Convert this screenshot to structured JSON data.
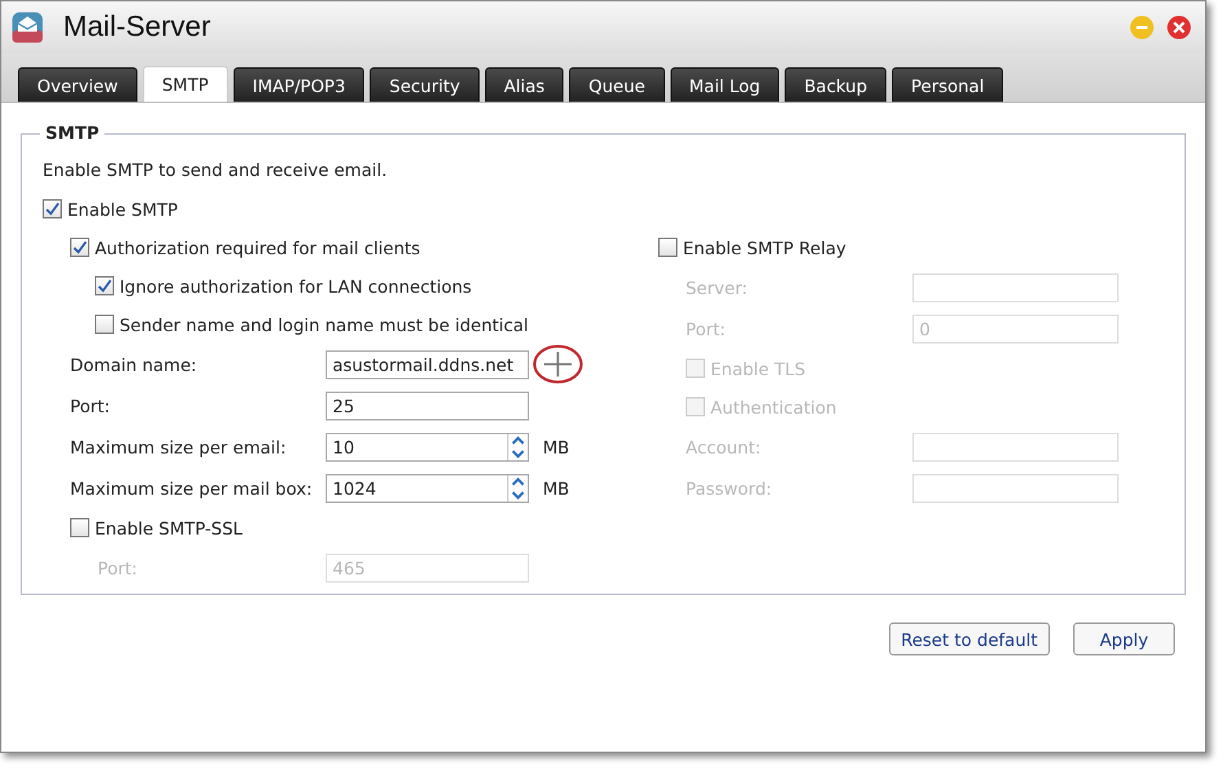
{
  "window": {
    "title": "Mail-Server"
  },
  "tabs": [
    {
      "label": "Overview",
      "selected": false
    },
    {
      "label": "SMTP",
      "selected": true
    },
    {
      "label": "IMAP/POP3",
      "selected": false
    },
    {
      "label": "Security",
      "selected": false
    },
    {
      "label": "Alias",
      "selected": false
    },
    {
      "label": "Queue",
      "selected": false
    },
    {
      "label": "Mail Log",
      "selected": false
    },
    {
      "label": "Backup",
      "selected": false
    },
    {
      "label": "Personal",
      "selected": false
    }
  ],
  "group": {
    "title": "SMTP",
    "description": "Enable SMTP to send and receive email."
  },
  "enable_smtp": {
    "label": "Enable SMTP",
    "checked": true
  },
  "authorization": {
    "label": "Authorization required for mail clients",
    "checked": true,
    "children": [
      {
        "label": "Ignore authorization for LAN connections",
        "checked": true
      },
      {
        "label": "Sender name and login name must be identical",
        "checked": false
      }
    ]
  },
  "smtp_fields": [
    {
      "kind": "field",
      "label": "Domain name:",
      "value": "asustormail.ddns.net",
      "annotated": true
    },
    {
      "kind": "field",
      "label": "Port:",
      "value": "25"
    },
    {
      "kind": "spinner",
      "label": "Maximum size per email:",
      "value": "10",
      "unit": "MB"
    },
    {
      "kind": "spinner",
      "label": "Maximum size per mail box:",
      "value": "1024",
      "unit": "MB"
    }
  ],
  "ssl": {
    "label": "Enable SMTP-SSL",
    "checked": false,
    "fields": [
      {
        "kind": "field",
        "label": "Port:",
        "value": "465",
        "disabled": true
      }
    ]
  },
  "relay": {
    "label": "Enable SMTP Relay",
    "checked": false,
    "items": [
      {
        "kind": "field",
        "label": "Server:",
        "disabled": true
      },
      {
        "kind": "field",
        "label": "Port:",
        "value": "0",
        "disabled": true
      },
      {
        "kind": "checkbox",
        "label": "Enable TLS",
        "checked": false,
        "disabled": true
      },
      {
        "kind": "checkbox",
        "label": "Authentication",
        "checked": false,
        "disabled": true
      },
      {
        "kind": "field",
        "label": "Account:",
        "disabled": true
      },
      {
        "kind": "field",
        "label": "Password:",
        "disabled": true
      }
    ]
  },
  "buttons": [
    "Reset to default",
    "Apply"
  ]
}
